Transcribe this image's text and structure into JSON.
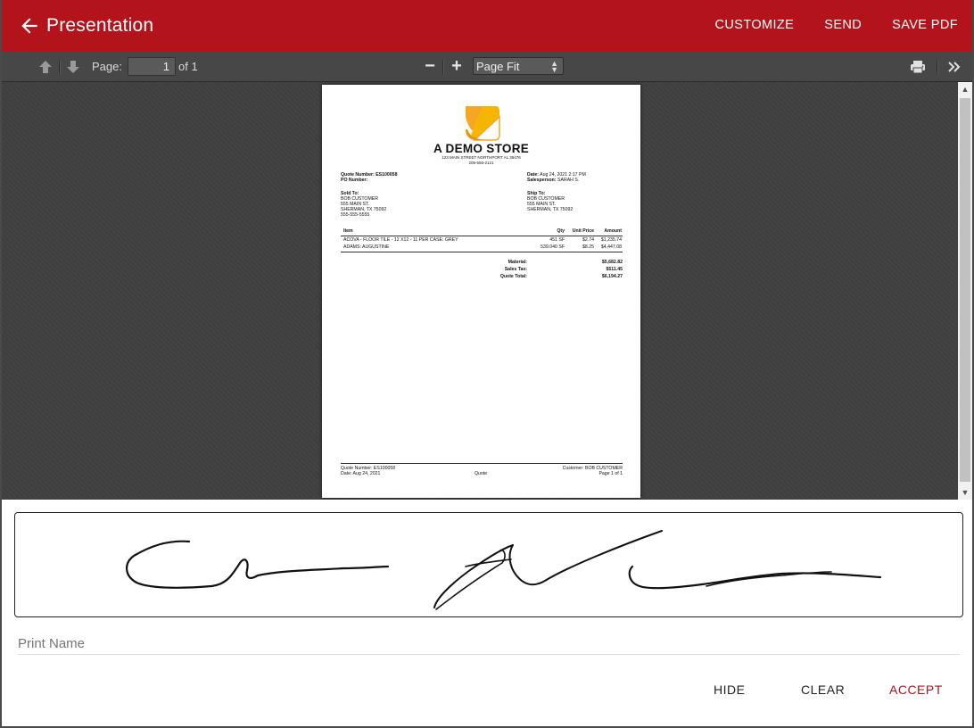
{
  "app": {
    "title": "Presentation",
    "actions": {
      "customize": "CUSTOMIZE",
      "send": "SEND",
      "save_pdf": "SAVE PDF"
    },
    "accent": "#b3131b"
  },
  "toolbar": {
    "page_label": "Page:",
    "page_value": "1",
    "of_label": "of 1",
    "zoom_value": "Page Fit"
  },
  "document": {
    "store_name": "A DEMO STORE",
    "store_address": "123 MAIN STREET NORTHPORT AL 35476",
    "store_phone": "205-555-2121",
    "quote_number_label": "Quote Number:",
    "quote_number": "ES100058",
    "po_label": "PO Number:",
    "date_label": "Date:",
    "date_value": "Aug 24, 2021 2:17 PM",
    "salesperson_label": "Salesperson:",
    "salesperson": "SARAH S.",
    "sold_to_label": "Sold To:",
    "sold_to": [
      "BOB CUSTOMER",
      "555 MAIN ST.",
      "SHERMAN, TX 75092",
      "555-555-5555"
    ],
    "ship_to_label": "Ship To:",
    "ship_to": [
      "BOB CUSTOMER",
      "555 MAIN ST.",
      "SHERMAN, TX 75092"
    ],
    "table_headers": {
      "item": "Item",
      "qty": "Qty",
      "unit_price": "Unit Price",
      "amount": "Amount"
    },
    "rows": [
      {
        "item": "ACOVA - FLOOR TILE - 12 X12 - 11 PER CASE: GREY",
        "qty": "451 SF",
        "unit_price": "$2.74",
        "amount": "$1,235.74"
      },
      {
        "item": "ADAMS: AUGUSTINE",
        "qty": "539.040 SF",
        "unit_price": "$8.25",
        "amount": "$4,447.08"
      }
    ],
    "totals": [
      {
        "label": "Material:",
        "value": "$5,682.82"
      },
      {
        "label": "Sales Tax:",
        "value": "$511.45"
      },
      {
        "label": "Quote Total:",
        "value": "$6,194.27"
      }
    ],
    "footer": {
      "quote_number": "Quote Number: ES100058",
      "date": "Date: Aug 24, 2021",
      "center": "Quote",
      "customer": "Customer: BOB CUSTOMER",
      "page": "Page 1 of 1"
    }
  },
  "signature": {
    "print_name_placeholder": "Print Name",
    "hide": "HIDE",
    "clear": "CLEAR",
    "accept": "ACCEPT"
  }
}
